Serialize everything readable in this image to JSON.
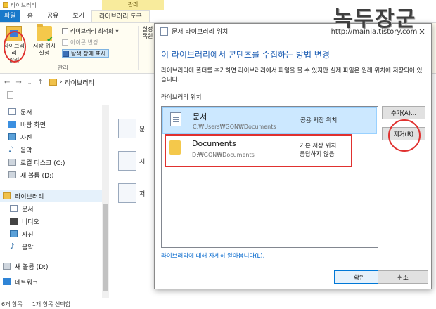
{
  "explorer": {
    "title": "라이브러리",
    "context_tab_header": "관리",
    "tabs": [
      "파일",
      "홈",
      "공유",
      "보기",
      "라이브러리 도구"
    ],
    "ribbon": {
      "manage_library": "라이브러리\n관리",
      "set_save_location": "저장 위치\n설정",
      "optimize_library": "라이브러리 최적화",
      "change_icon": "아이콘 변경",
      "show_in_nav": "탐색 창에 표시",
      "group_label": "관리",
      "right_partial": "설정\n목원"
    },
    "address": {
      "crumb": "라이브러리"
    },
    "nav_items": [
      {
        "label": "문서",
        "icon": "doc"
      },
      {
        "label": "바탕 화면",
        "icon": "desk"
      },
      {
        "label": "사진",
        "icon": "pic"
      },
      {
        "label": "음악",
        "icon": "music"
      },
      {
        "label": "로컬 디스크 (C:)",
        "icon": "disk"
      },
      {
        "label": "새 볼륨 (D:)",
        "icon": "disk"
      }
    ],
    "library_group": "라이브러리",
    "library_items": [
      {
        "label": "문서",
        "icon": "doc"
      },
      {
        "label": "비디오",
        "icon": "vid"
      },
      {
        "label": "사진",
        "icon": "pic"
      },
      {
        "label": "음악",
        "icon": "music"
      }
    ],
    "other_items": [
      {
        "label": "새 볼륨 (D:)",
        "icon": "disk"
      },
      {
        "label": "네트워크",
        "icon": "net"
      }
    ],
    "content_labels": [
      "문",
      "시",
      "저"
    ],
    "status": {
      "count": "6개 항목",
      "selected": "1개 항목 선택함"
    }
  },
  "dialog": {
    "title": "문서 라이브러리 위치",
    "close": "×",
    "heading": "이 라이브러리에서 콘텐츠를 수집하는 방법 변경",
    "description": "라이브러리에 폴더를 추가하면 라이브러리에서 파일을 볼 수 있지만 실제 파일은 원래 위치에 저장되어 있습니다.",
    "locations_label": "라이브러리 위치",
    "locations": [
      {
        "name": "문서",
        "path": "C:₩Users₩GON₩Documents",
        "status": "공용 저장 위치"
      },
      {
        "name": "Documents",
        "path": "D:₩GON₩Documents",
        "status": "기본 저장 위치\n응답하지 않음"
      }
    ],
    "add_button": "추가(A)...",
    "remove_button": "제거(R)",
    "learn_more": "라이브러리에 대해 자세히 알아봅니다(L).",
    "ok_button": "확인",
    "cancel_button": "취소"
  },
  "watermark": {
    "title": "녹두장군",
    "url": "http://mainia.tistory.com"
  },
  "colors": {
    "accent": "#1f5fb4",
    "file_tab": "#1979ca",
    "annotation": "#e0312f",
    "context_tab": "#f8eb9c"
  }
}
